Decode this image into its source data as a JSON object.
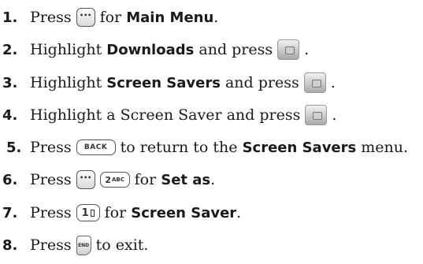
{
  "steps": [
    {
      "number": "1.",
      "segments": [
        "Press",
        "for",
        "Main Menu",
        "."
      ],
      "key_icon": "menu-key-icon",
      "key_label": "•••"
    },
    {
      "number": "2.",
      "segments": [
        "Highlight",
        "Downloads",
        "and press",
        "."
      ],
      "key_icon": "ok-key-icon"
    },
    {
      "number": "3.",
      "segments": [
        "Highlight",
        "Screen Savers",
        "and press",
        "."
      ],
      "key_icon": "ok-key-icon"
    },
    {
      "number": "4.",
      "segments": [
        "Highlight a Screen Saver and press",
        "."
      ],
      "key_icon": "ok-key-icon"
    },
    {
      "number": "5.",
      "segments": [
        "Press",
        "to return to the",
        "Screen Savers",
        "menu."
      ],
      "key_icon": "back-key-icon",
      "key_label": "BACK"
    },
    {
      "number": "6.",
      "segments": [
        "Press",
        "for",
        "Set as",
        "."
      ],
      "key_icons": [
        "menu-key-icon",
        "two-abc-key-icon"
      ],
      "key_label_menu": "•••",
      "key_label_main": "2",
      "key_label_small": "ABC"
    },
    {
      "number": "7.",
      "segments": [
        "Press",
        "for",
        "Screen Saver",
        "."
      ],
      "key_icon": "one-voicemail-key-icon",
      "key_label": "1"
    },
    {
      "number": "8.",
      "segments": [
        "Press",
        "to exit."
      ],
      "key_icon": "end-key-icon",
      "key_label": "END"
    }
  ]
}
